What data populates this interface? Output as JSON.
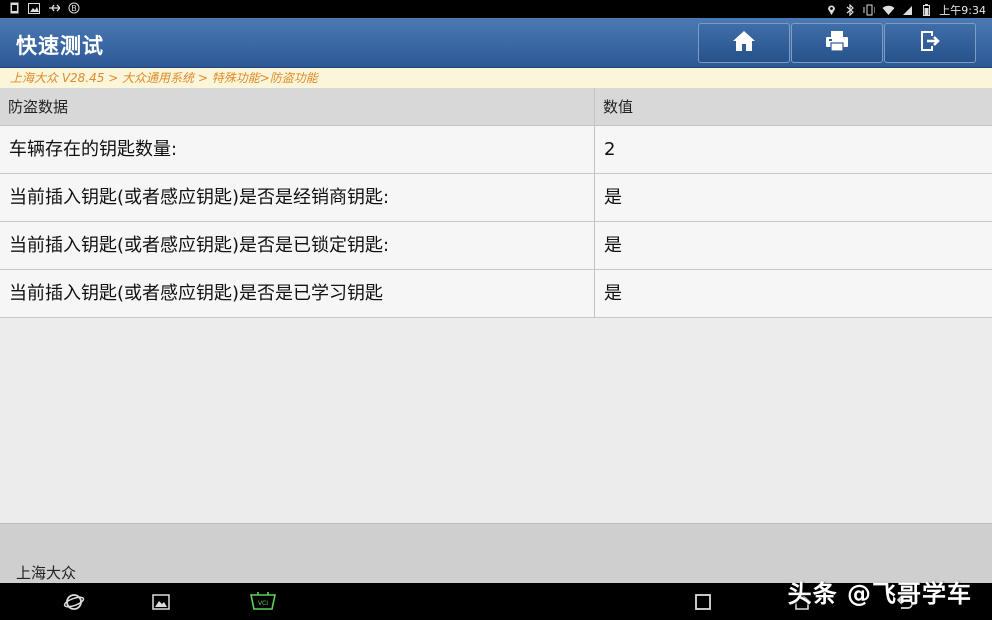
{
  "status_bar": {
    "time": "上午9:34",
    "left_icons": [
      "sim-icon",
      "image-icon",
      "usb-debug-icon",
      "bug-icon"
    ],
    "right_icons": [
      "location-icon",
      "bluetooth-icon",
      "vibrate-icon",
      "wifi-icon",
      "signal-icon",
      "battery-icon"
    ]
  },
  "app": {
    "title": "快速测试",
    "buttons": [
      "home-icon",
      "print-icon",
      "exit-icon"
    ],
    "accent": "#2d5a96"
  },
  "breadcrumb": "上海大众 V28.45 > 大众通用系统 > 特殊功能>防盗功能",
  "table": {
    "headers": [
      "防盗数据",
      "数值"
    ],
    "rows": [
      {
        "name": "车辆存在的钥匙数量:",
        "value": "2"
      },
      {
        "name": "当前插入钥匙(或者感应钥匙)是否是经销商钥匙:",
        "value": "是"
      },
      {
        "name": "当前插入钥匙(或者感应钥匙)是否是已锁定钥匙:",
        "value": "是"
      },
      {
        "name": "当前插入钥匙(或者感应钥匙)是否是已学习钥匙",
        "value": "是"
      }
    ]
  },
  "footer": {
    "label": "上海大众"
  },
  "nav_bar": {
    "icons": [
      "browser-icon",
      "gallery-icon",
      "vci-icon",
      "recent-apps-icon",
      "home-nav-icon",
      "back-icon"
    ]
  },
  "watermark": "头条 @飞哥学车"
}
